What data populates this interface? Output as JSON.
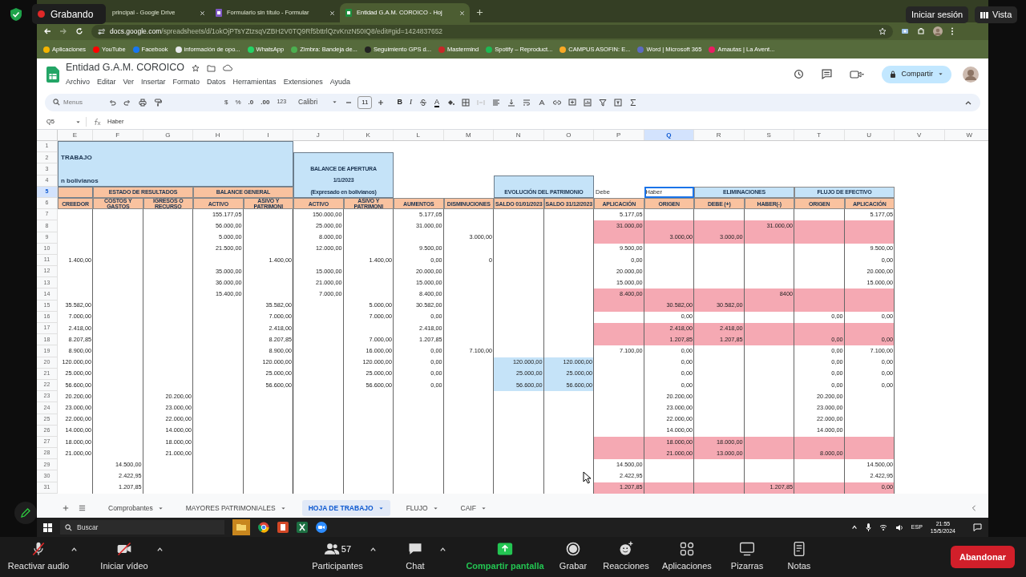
{
  "recording_indicator": {
    "label": "Grabando"
  },
  "overlay_buttons": [
    {
      "label": "Iniciar sesión",
      "kind": "sign-in"
    },
    {
      "label": "Vista",
      "kind": "view"
    }
  ],
  "browser": {
    "tabs": [
      {
        "label": "principal - Google Drive",
        "selected": false
      },
      {
        "label": "Formulario sin título - Formular",
        "selected": false,
        "color": "#7e57c2"
      },
      {
        "label": "Entidad G.A.M. COROICO - Hoj",
        "selected": true,
        "color": "#1e8e3e"
      }
    ],
    "url": {
      "host": "docs.google.com",
      "path": "/spreadsheets/d/1okOjPTsYZtzsqVZBH2V0TQ9Rf5bttrlQzvKnzN50IQ8/edit#gid=1424837652"
    },
    "bookmarks": [
      {
        "label": "Aplicaciones",
        "color": "#f4b400"
      },
      {
        "label": "YouTube",
        "color": "#ff0000"
      },
      {
        "label": "Facebook",
        "color": "#1877f2"
      },
      {
        "label": "información de opo...",
        "color": "#e8eaed"
      },
      {
        "label": "WhatsApp",
        "color": "#25d366"
      },
      {
        "label": "Zimbra: Bandeja de...",
        "color": "#4caf50"
      },
      {
        "label": "Seguimiento GPS d...",
        "color": "#222222"
      },
      {
        "label": "Mastermind",
        "color": "#c62828"
      },
      {
        "label": "Spotify – Reproduct...",
        "color": "#1db954"
      },
      {
        "label": "CAMPUS ASOFIN: E...",
        "color": "#f9a825"
      },
      {
        "label": "Word | Microsoft 365",
        "color": "#5c6bc0"
      },
      {
        "label": "Amautas | La Avent...",
        "color": "#e91e63"
      }
    ]
  },
  "sheets": {
    "title": "Entidad G.A.M. COROICO",
    "menu": [
      "Archivo",
      "Editar",
      "Ver",
      "Insertar",
      "Formato",
      "Datos",
      "Herramientas",
      "Extensiones",
      "Ayuda"
    ],
    "share_button": "Compartir",
    "toolbar": {
      "search": {
        "placeholder": "Menus"
      },
      "currency": "$",
      "percent": "%",
      "decrease_decimals": ".0",
      "increase_decimals": ".00",
      "more_formats": "123",
      "font": "Calibri",
      "font_size": "11",
      "bold": "B",
      "italic": "I",
      "text_color": "A"
    },
    "name_box": "Q5",
    "formula": "Haber",
    "column_headers": [
      {
        "label": "E",
        "selected": false
      },
      {
        "label": "F",
        "selected": false
      },
      {
        "label": "G",
        "selected": false
      },
      {
        "label": "H",
        "selected": false
      },
      {
        "label": "I",
        "selected": false
      },
      {
        "label": "J",
        "selected": false
      },
      {
        "label": "K",
        "selected": false
      },
      {
        "label": "L",
        "selected": false
      },
      {
        "label": "M",
        "selected": false
      },
      {
        "label": "N",
        "selected": false
      },
      {
        "label": "O",
        "selected": false
      },
      {
        "label": "P",
        "selected": false
      },
      {
        "label": "Q",
        "selected": true
      },
      {
        "label": "R",
        "selected": false
      },
      {
        "label": "S",
        "selected": false
      },
      {
        "label": "T",
        "selected": false
      },
      {
        "label": "U",
        "selected": false
      },
      {
        "label": "V",
        "selected": false
      },
      {
        "label": "W",
        "selected": false
      }
    ],
    "row_headers": [
      {
        "label": "1",
        "selected": false
      },
      {
        "label": "2",
        "selected": false
      },
      {
        "label": "3",
        "selected": false
      },
      {
        "label": "4",
        "selected": false
      },
      {
        "label": "5",
        "selected": true
      },
      {
        "label": "6",
        "selected": false
      },
      {
        "label": "7",
        "selected": false
      },
      {
        "label": "8",
        "selected": false
      },
      {
        "label": "9",
        "selected": false
      },
      {
        "label": "10",
        "selected": false
      },
      {
        "label": "11",
        "selected": false
      },
      {
        "label": "12",
        "selected": false
      },
      {
        "label": "13",
        "selected": false
      },
      {
        "label": "14",
        "selected": false
      },
      {
        "label": "15",
        "selected": false
      },
      {
        "label": "16",
        "selected": false
      },
      {
        "label": "17",
        "selected": false
      },
      {
        "label": "18",
        "selected": false
      },
      {
        "label": "19",
        "selected": false
      },
      {
        "label": "20",
        "selected": false
      },
      {
        "label": "21",
        "selected": false
      },
      {
        "label": "22",
        "selected": false
      },
      {
        "label": "23",
        "selected": false
      },
      {
        "label": "24",
        "selected": false
      },
      {
        "label": "25",
        "selected": false
      },
      {
        "label": "26",
        "selected": false
      },
      {
        "label": "27",
        "selected": false
      },
      {
        "label": "28",
        "selected": false
      },
      {
        "label": "29",
        "selected": false
      },
      {
        "label": "30",
        "selected": false
      },
      {
        "label": "31",
        "selected": false
      }
    ],
    "header_blocks": [
      {
        "kind": "fill",
        "color": "#c5e3f8",
        "selected": false
      },
      {
        "kind": "title",
        "text": "TRABAJO",
        "selected": false
      },
      {
        "kind": "fill",
        "color": "#c5e3f8",
        "selected": false
      },
      {
        "kind": "header",
        "text": "BALANCE DE APERTURA",
        "selected": false
      },
      {
        "kind": "title",
        "text": "n bolivianos",
        "selected": false
      },
      {
        "kind": "header",
        "text": "1/1/2023",
        "selected": false
      },
      {
        "kind": "fill",
        "color": "#c5e3f8",
        "selected": false
      },
      {
        "kind": "fill",
        "color": "#f9c29f",
        "selected": false
      },
      {
        "kind": "header",
        "text": "ESTADO DE RESULTADOS",
        "color": "#f9c29f",
        "selected": false
      },
      {
        "kind": "header",
        "text": "BALANCE GENERAL",
        "color": "#f9c29f",
        "selected": false
      },
      {
        "kind": "header",
        "text": "(Expresado en bolivianos)",
        "selected": false
      },
      {
        "kind": "header",
        "text": "EVOLUCIÓN DEL PATRIMONIO",
        "selected": false
      },
      {
        "kind": "label",
        "text": "Debe",
        "selected": false
      },
      {
        "kind": "label",
        "text": "Haber",
        "selected": true
      },
      {
        "kind": "header",
        "text": "ELIMINACIONES",
        "color": "#c5e3f8",
        "selected": false
      },
      {
        "kind": "header",
        "text": "FLUJO DE EFECTIVO",
        "color": "#c5e3f8",
        "selected": false
      }
    ],
    "column_titles": [
      {
        "text": "CREEDOR",
        "color": "#f9c29f"
      },
      {
        "text": "COSTOS Y GASTOS",
        "color": "#f9c29f"
      },
      {
        "text": "IGRESOS O RECURSO",
        "color": "#f9c29f"
      },
      {
        "text": "ACTIVO",
        "color": "#f9c29f"
      },
      {
        "text": "ASIVO Y PATRIMONI",
        "color": "#f9c29f"
      },
      {
        "text": "ACTIVO",
        "color": "#f9c29f"
      },
      {
        "text": "ASIVO Y PATRIMONI",
        "color": "#f9c29f"
      },
      {
        "text": "AUMENTOS",
        "color": "#f9c29f"
      },
      {
        "text": "DISMINUCIONES",
        "color": "#f9c29f"
      },
      {
        "text": "SALDO 01/01/2023",
        "color": "#f9c29f"
      },
      {
        "text": "SALDO 31/12/2023",
        "color": "#f9c29f"
      },
      {
        "text": "APLICACIÓN",
        "color": "#f9c29f"
      },
      {
        "text": "ORIGEN",
        "color": "#f9c29f"
      },
      {
        "text": "DEBE (+)",
        "color": "#f9c29f"
      },
      {
        "text": "HABER(-)",
        "color": "#f9c29f"
      },
      {
        "text": "ORIGEN",
        "color": "#f9c29f"
      },
      {
        "text": "APLICACIÓN",
        "color": "#f9c29f"
      }
    ],
    "rows": [
      {
        "cells": {
          "H": "155.177,05",
          "J": "150.000,00",
          "L": "5.177,05",
          "P": "5.177,05",
          "U": "5.177,05"
        }
      },
      {
        "color": "#f5a9b3",
        "cells": {
          "H": "56.000,00",
          "J": "25.000,00",
          "L": "31.000,00",
          "P": "31.000,00",
          "S": "31.000,00"
        }
      },
      {
        "color": "#f5a9b3",
        "cells": {
          "H": "5.000,00",
          "J": "8.000,00",
          "M": "3.000,00",
          "Q": "3.000,00",
          "R": "3.000,00"
        }
      },
      {
        "cells": {
          "H": "21.500,00",
          "J": "12.000,00",
          "L": "9.500,00",
          "P": "9.500,00",
          "U": "9.500,00"
        }
      },
      {
        "cells": {
          "E": "1.400,00",
          "I": "1.400,00",
          "K": "1.400,00",
          "L": "0,00",
          "M": "0",
          "P": "0,00",
          "U": "0,00"
        }
      },
      {
        "cells": {
          "H": "35.000,00",
          "J": "15.000,00",
          "L": "20.000,00",
          "P": "20.000,00",
          "U": "20.000,00"
        }
      },
      {
        "cells": {
          "H": "36.000,00",
          "J": "21.000,00",
          "L": "15.000,00",
          "P": "15.000,00",
          "U": "15.000,00"
        }
      },
      {
        "color": "#f5a9b3",
        "cells": {
          "H": "15.400,00",
          "J": "7.000,00",
          "L": "8.400,00",
          "P": "8.400,00",
          "S": "8400"
        }
      },
      {
        "color": "#f5a9b3",
        "cells": {
          "E": "35.582,00",
          "I": "35.582,00",
          "K": "5.000,00",
          "L": "30.582,00",
          "Q": "30.582,00",
          "R": "30.582,00"
        }
      },
      {
        "cells": {
          "E": "7.000,00",
          "I": "7.000,00",
          "K": "7.000,00",
          "L": "0,00",
          "Q": "0,00",
          "T": "0,00",
          "U": "0,00"
        }
      },
      {
        "color": "#f5a9b3",
        "cells": {
          "E": "2.418,00",
          "I": "2.418,00",
          "L": "2.418,00",
          "Q": "2.418,00",
          "R": "2.418,00"
        }
      },
      {
        "color": "#f5a9b3",
        "cells": {
          "E": "8.207,85",
          "I": "8.207,85",
          "K": "7.000,00",
          "L": "1.207,85",
          "Q": "1.207,85",
          "R": "1.207,85",
          "T": "0,00",
          "U": "0,00"
        }
      },
      {
        "cells": {
          "E": "8.900,00",
          "I": "8.900,00",
          "K": "16.000,00",
          "L": "0,00",
          "M": "7.100,00",
          "P": "7.100,00",
          "Q": "0,00",
          "T": "0,00",
          "U": "7.100,00"
        }
      },
      {
        "bands": [
          {
            "kind": "saldo",
            "color": "#c5e3f8"
          }
        ],
        "cells": {
          "E": "120.000,00",
          "I": "120.000,00",
          "K": "120.000,00",
          "L": "0,00",
          "N": "120.000,00",
          "O": "120.000,00",
          "Q": "0,00",
          "T": "0,00",
          "U": "0,00"
        }
      },
      {
        "bands": [
          {
            "kind": "saldo",
            "color": "#c5e3f8"
          }
        ],
        "cells": {
          "E": "25.000,00",
          "I": "25.000,00",
          "K": "25.000,00",
          "L": "0,00",
          "N": "25.000,00",
          "O": "25.000,00",
          "Q": "0,00",
          "T": "0,00",
          "U": "0,00"
        }
      },
      {
        "bands": [
          {
            "kind": "saldo",
            "color": "#c5e3f8"
          }
        ],
        "cells": {
          "E": "56.600,00",
          "I": "56.600,00",
          "K": "56.600,00",
          "L": "0,00",
          "N": "56.600,00",
          "O": "56.600,00",
          "Q": "0,00",
          "T": "0,00",
          "U": "0,00"
        }
      },
      {
        "cells": {
          "E": "20.200,00",
          "G": "20.200,00",
          "Q": "20.200,00",
          "T": "20.200,00"
        }
      },
      {
        "cells": {
          "E": "23.000,00",
          "G": "23.000,00",
          "Q": "23.000,00",
          "T": "23.000,00"
        }
      },
      {
        "cells": {
          "E": "22.000,00",
          "G": "22.000,00",
          "Q": "22.000,00",
          "T": "22.000,00"
        }
      },
      {
        "cells": {
          "E": "14.000,00",
          "G": "14.000,00",
          "Q": "14.000,00",
          "T": "14.000,00"
        }
      },
      {
        "color": "#f5a9b3",
        "cells": {
          "E": "18.000,00",
          "G": "18.000,00",
          "Q": "18.000,00",
          "R": "18.000,00"
        }
      },
      {
        "color": "#f5a9b3",
        "cells": {
          "E": "21.000,00",
          "G": "21.000,00",
          "Q": "21.000,00",
          "R": "13.000,00",
          "T": "8.000,00"
        }
      },
      {
        "cells": {
          "F": "14.500,00",
          "P": "14.500,00",
          "U": "14.500,00"
        }
      },
      {
        "cells": {
          "F": "2.422,95",
          "P": "2.422,95",
          "U": "2.422,95"
        }
      },
      {
        "color": "#f5a9b3",
        "cells": {
          "F": "1.207,85",
          "P": "1.207,85",
          "S": "1.207,85",
          "U": "0,00"
        }
      }
    ],
    "sheet_tabs": [
      {
        "label": "Comprobantes",
        "selected": false
      },
      {
        "label": "MAYORES PATRIMONIALES",
        "selected": false
      },
      {
        "label": "HOJA DE TRABAJO",
        "selected": true
      },
      {
        "label": "FLUJO",
        "selected": false
      },
      {
        "label": "CAIF",
        "selected": false
      }
    ]
  },
  "taskbar": {
    "search": {
      "placeholder": "Buscar"
    },
    "language": "ESP",
    "time": "21:55",
    "date": "15/5/2024"
  },
  "meeting_bar": {
    "items": [
      {
        "kind": "audio",
        "label": "Reactivar audio",
        "has_menu": true
      },
      {
        "kind": "video",
        "label": "Iniciar vídeo",
        "has_menu": true
      },
      {
        "kind": "participants",
        "label": "Participantes",
        "count": "57",
        "has_menu": true
      },
      {
        "kind": "chat",
        "label": "Chat",
        "has_menu": true
      },
      {
        "kind": "share",
        "label": "Compartir pantalla",
        "has_menu": false
      },
      {
        "kind": "record",
        "label": "Grabar",
        "has_menu": false
      },
      {
        "kind": "reactions",
        "label": "Reacciones",
        "has_menu": false
      },
      {
        "kind": "apps",
        "label": "Aplicaciones",
        "has_menu": false
      },
      {
        "kind": "whiteboard",
        "label": "Pizarras",
        "has_menu": false
      },
      {
        "kind": "notes",
        "label": "Notas",
        "has_menu": false
      }
    ],
    "leave_button": "Abandonar"
  }
}
